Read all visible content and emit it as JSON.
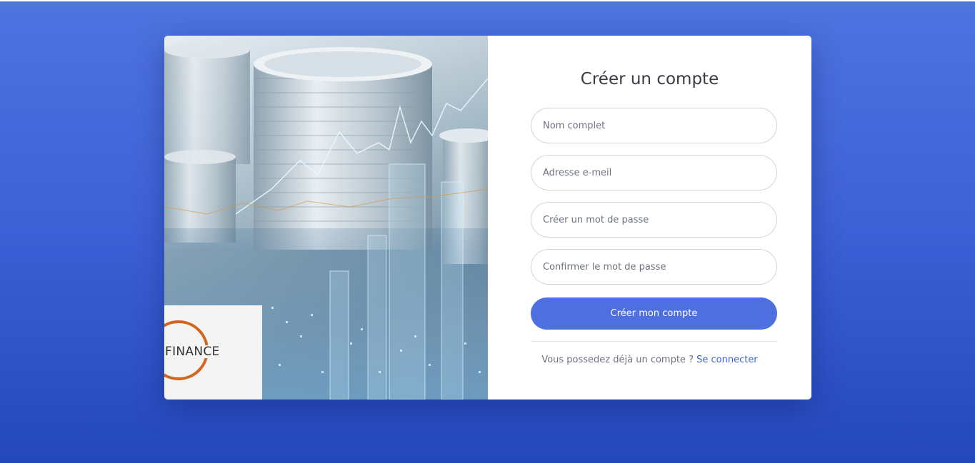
{
  "page": {
    "background_color": "#4468dc"
  },
  "hero": {
    "image_description_icon": "coins-finance-image",
    "logo": {
      "text": "FINANCE",
      "ring_color": "#d2661d"
    }
  },
  "form": {
    "title": "Créer un compte",
    "fields": [
      {
        "placeholder": "Nom complet",
        "value": ""
      },
      {
        "placeholder": "Adresse e-meil",
        "value": ""
      },
      {
        "placeholder": "Créer un mot de passe",
        "value": ""
      },
      {
        "placeholder": "Confirmer le mot de passe",
        "value": ""
      }
    ],
    "submit_label": "Créer mon compte",
    "accent_color": "#4e6fe0",
    "footer_text": "Vous possedez déjà un compte ?",
    "login_link": "Se connecter"
  }
}
